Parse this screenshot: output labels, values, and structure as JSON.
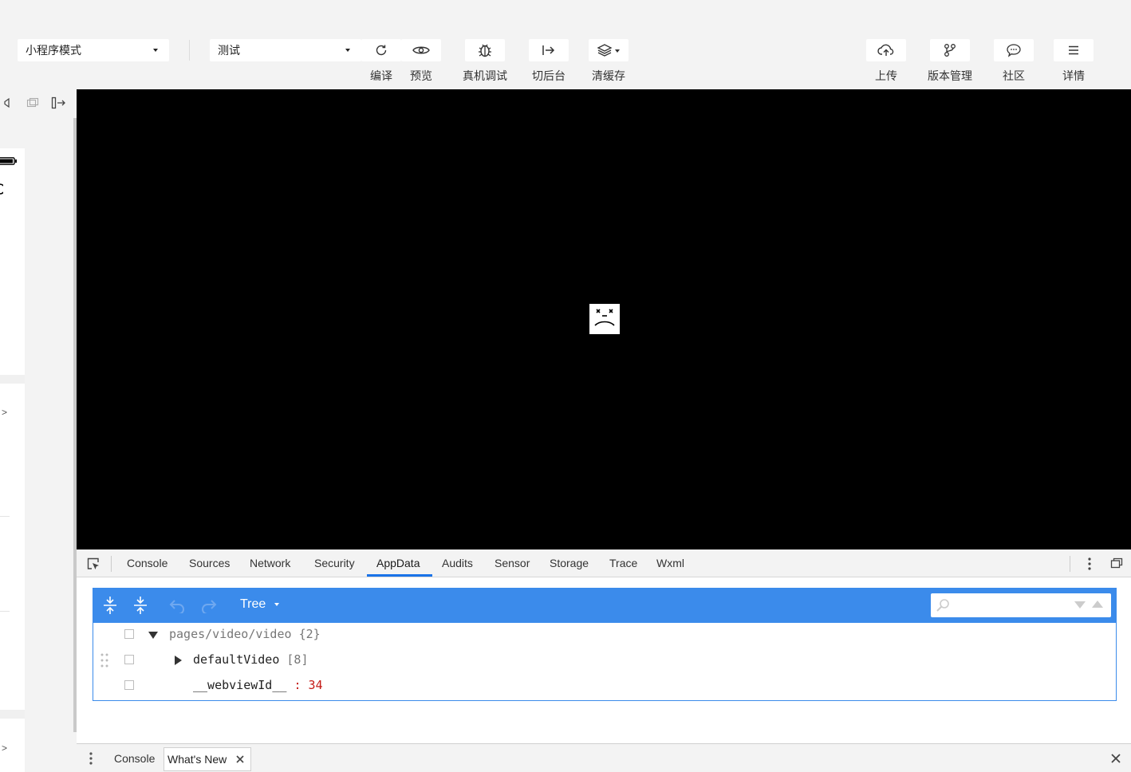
{
  "toolbar": {
    "mode_select": "小程序模式",
    "compile_select": "测试",
    "buttons": {
      "compile": "编译",
      "preview": "预览",
      "remote_debug": "真机调试",
      "background": "切后台",
      "clear_cache": "清缓存",
      "upload": "上传",
      "version": "版本管理",
      "community": "社区",
      "details": "详情"
    }
  },
  "simulator": {
    "chevron_1": ">",
    "chevron_2": ">"
  },
  "devtools": {
    "tabs": [
      "Console",
      "Sources",
      "Network",
      "Security",
      "AppData",
      "Audits",
      "Sensor",
      "Storage",
      "Trace",
      "Wxml"
    ],
    "active_tab": "AppData",
    "appdata": {
      "view_mode": "Tree",
      "tree": {
        "root_key": "pages/video/video",
        "root_count": "{2}",
        "child1_key": "defaultVideo",
        "child1_count": "[8]",
        "child2_key": "__webviewId__",
        "child2_sep": ":",
        "child2_value": "34"
      }
    },
    "drawer": {
      "tabs": [
        "Console",
        "What's New"
      ],
      "active_tab": "What's New"
    }
  },
  "colors": {
    "accent": "#3b8beb",
    "number_value": "#c41a16",
    "active_tab_underline": "#1a73e8"
  }
}
